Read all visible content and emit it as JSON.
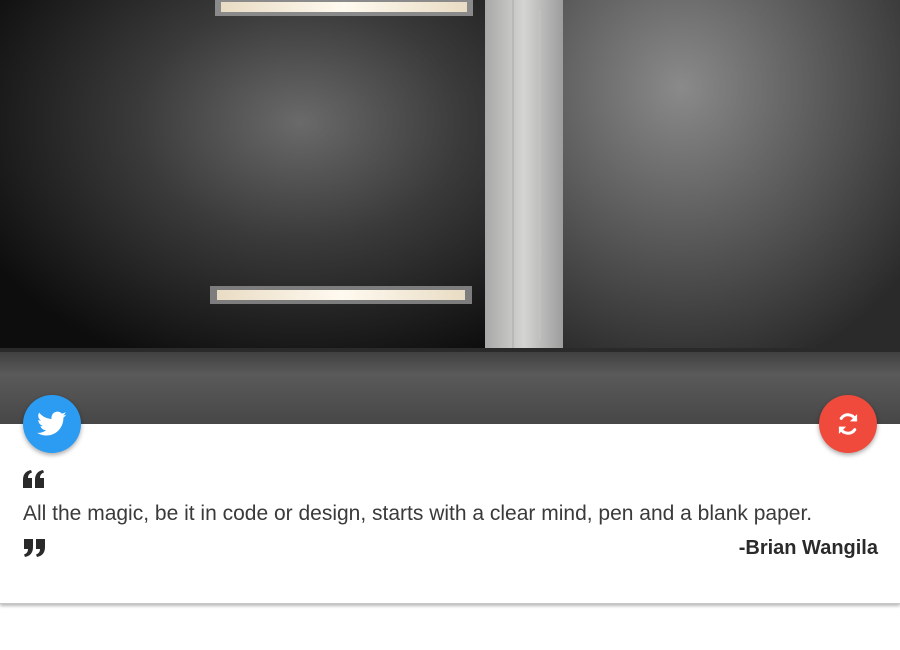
{
  "quote": {
    "text": "All the magic, be it in code or design, starts with a clear mind, pen and a blank paper.",
    "author": "-Brian Wangila"
  },
  "buttons": {
    "tweet_icon": "twitter-icon",
    "new_quote_icon": "refresh-icon"
  },
  "colors": {
    "twitter_blue": "#2b9cf2",
    "refresh_red": "#ef4a3b",
    "quote_text": "#3a3a3a",
    "author_text": "#2a2a2a"
  }
}
